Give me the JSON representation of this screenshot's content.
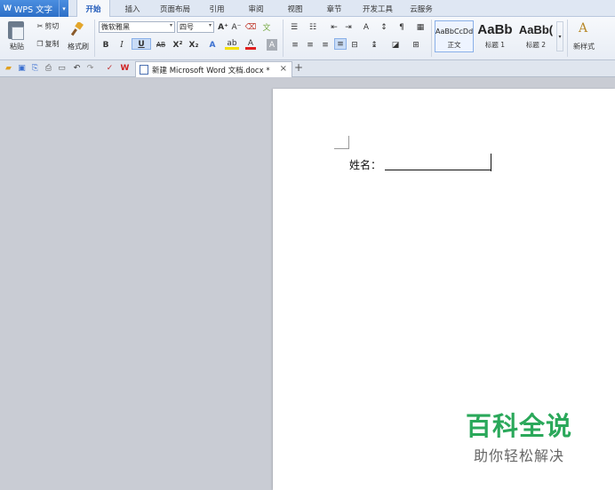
{
  "app": {
    "title": "WPS 文字",
    "logo_letter": "W",
    "dropdown_glyph": "▾"
  },
  "menu": {
    "tabs": [
      "开始",
      "插入",
      "页面布局",
      "引用",
      "审阅",
      "视图",
      "章节",
      "开发工具",
      "云服务"
    ],
    "active_tab": "开始"
  },
  "ribbon": {
    "clipboard": {
      "paste": "粘贴",
      "cut": "剪切",
      "copy": "复制",
      "format_painter": "格式刷"
    },
    "font": {
      "name": "微软雅黑",
      "size": "四号",
      "bold": "B",
      "italic": "I",
      "underline": "U",
      "strike": "AB",
      "superscript": "X²",
      "subscript": "X₂",
      "grow": "A⁺",
      "shrink": "A⁻",
      "text_effect": "A",
      "highlight": "ab",
      "font_color": "A",
      "char_shading": "A"
    },
    "styles": [
      {
        "sample": "AaBbCcDd",
        "name": "正文"
      },
      {
        "sample": "AaBb",
        "name": "标题 1"
      },
      {
        "sample": "AaBb(",
        "name": "标题 2"
      }
    ],
    "new_style": "新样式"
  },
  "document": {
    "tab_title": "新建 Microsoft Word 文档.docx *",
    "close_glyph": "×",
    "new_tab_glyph": "+",
    "content": {
      "field_label": "姓名："
    }
  },
  "watermark": {
    "title": "百科全说",
    "subtitle": "助你轻松解决"
  },
  "colors": {
    "accent": "#2d6fc7",
    "active_tab_text": "#1d57b8",
    "watermark": "#2aa85a",
    "workspace_bg": "#c9ccd4"
  }
}
